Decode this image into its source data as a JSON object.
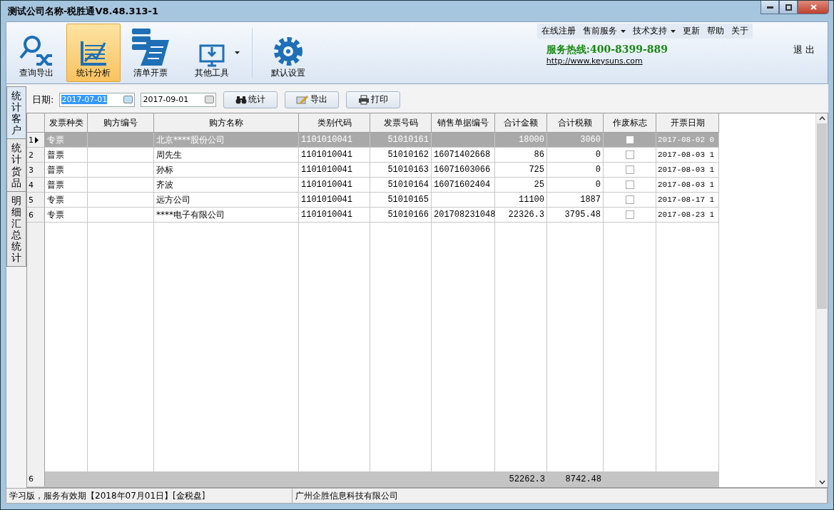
{
  "window": {
    "title": "测试公司名称-税胜通V8.48.313-1"
  },
  "ribbon": {
    "buttons": [
      {
        "label": "查询导出",
        "selected": false,
        "dropdown": false
      },
      {
        "label": "统计分析",
        "selected": true,
        "dropdown": false
      },
      {
        "label": "清单开票",
        "selected": false,
        "dropdown": false
      },
      {
        "label": "其他工具",
        "selected": false,
        "dropdown": true
      },
      {
        "label": "默认设置",
        "selected": false,
        "dropdown": false
      }
    ],
    "menu": [
      {
        "label": "在线注册",
        "dropdown": false
      },
      {
        "label": "售前服务",
        "dropdown": true
      },
      {
        "label": "技术支持",
        "dropdown": true
      },
      {
        "label": "更新",
        "dropdown": false
      },
      {
        "label": "帮助",
        "dropdown": false
      },
      {
        "label": "关于",
        "dropdown": false
      }
    ],
    "hotline": "服务热线:400-8399-889",
    "website": "http://www.keysuns.com",
    "exit": "退 出"
  },
  "side_tabs": [
    {
      "label": "统计客户",
      "selected": true
    },
    {
      "label": "统计货品",
      "selected": false
    },
    {
      "label": "明细汇总统计",
      "selected": false
    }
  ],
  "filter": {
    "date_label": "日期:",
    "date_from": "2017-07-01",
    "date_to": "2017-09-01",
    "buttons": [
      {
        "label": "统计"
      },
      {
        "label": "导出"
      },
      {
        "label": "打印"
      }
    ]
  },
  "table": {
    "columns": [
      "发票种类",
      "购方编号",
      "购方名称",
      "类别代码",
      "发票号码",
      "销售单据编号",
      "合计金额",
      "合计税额",
      "作废标志",
      "开票日期"
    ],
    "rows": [
      {
        "number": "1",
        "selected": true,
        "type": "专票",
        "buyer_no": "",
        "buyer": "北京****股份公司",
        "category_code": "1101010041",
        "invoice_no": "51010161",
        "sales_no": "",
        "amount": "18000",
        "tax": "3060",
        "void": false,
        "date": "2017-08-02 0"
      },
      {
        "number": "2",
        "selected": false,
        "type": "普票",
        "buyer_no": "",
        "buyer": "周先生",
        "category_code": "1101010041",
        "invoice_no": "51010162",
        "sales_no": "16071402668",
        "amount": "86",
        "tax": "0",
        "void": false,
        "date": "2017-08-03 1"
      },
      {
        "number": "3",
        "selected": false,
        "type": "普票",
        "buyer_no": "",
        "buyer": "孙标",
        "category_code": "1101010041",
        "invoice_no": "51010163",
        "sales_no": "16071603066",
        "amount": "725",
        "tax": "0",
        "void": false,
        "date": "2017-08-03 1"
      },
      {
        "number": "4",
        "selected": false,
        "type": "普票",
        "buyer_no": "",
        "buyer": "齐波",
        "category_code": "1101010041",
        "invoice_no": "51010164",
        "sales_no": "16071602404",
        "amount": "25",
        "tax": "0",
        "void": false,
        "date": "2017-08-03 1"
      },
      {
        "number": "5",
        "selected": false,
        "type": "专票",
        "buyer_no": "",
        "buyer": "远方公司",
        "category_code": "1101010041",
        "invoice_no": "51010165",
        "sales_no": "",
        "amount": "11100",
        "tax": "1887",
        "void": false,
        "date": "2017-08-17 1"
      },
      {
        "number": "6",
        "selected": false,
        "type": "专票",
        "buyer_no": "",
        "buyer": "****电子有限公司",
        "category_code": "1101010041",
        "invoice_no": "51010166",
        "sales_no": "201708231048",
        "amount": "22326.3",
        "tax": "3795.48",
        "void": false,
        "date": "2017-08-23 1"
      }
    ],
    "footer": {
      "row_count": "6",
      "total_amount": "52262.3",
      "total_tax": "8742.48"
    }
  },
  "status_bar": {
    "license": "学习版，服务有效期【2018年07月01日】[金税盘]",
    "company": "广州企胜信息科技有限公司"
  }
}
